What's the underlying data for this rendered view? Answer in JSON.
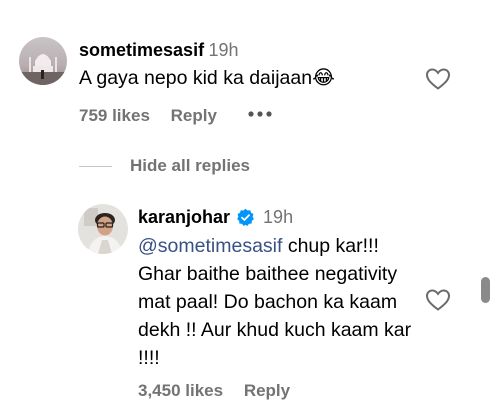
{
  "thread": {
    "comment": {
      "username": "sometimesasif",
      "time": "19h",
      "text": "A gaya nepo kid ka daijaan",
      "emoji": "😂",
      "likes": "759 likes",
      "reply_label": "Reply",
      "more_icon": "more-horizontal-icon",
      "like_icon": "heart-outline-icon"
    },
    "replies_toggle": "Hide all replies",
    "reply": {
      "username": "karanjohar",
      "verified_icon": "verified-badge-icon",
      "time": "19h",
      "mention": "@sometimesasif",
      "text": " chup kar!!! Ghar baithe baithee negativity mat paal! Do bachon ka kaam dekh !! Aur khud kuch kaam kar !!!!",
      "likes": "3,450 likes",
      "reply_label": "Reply",
      "like_icon": "heart-outline-icon"
    }
  },
  "colors": {
    "secondary_text": "#737373",
    "mention": "#385185",
    "verified": "#0095f6"
  }
}
